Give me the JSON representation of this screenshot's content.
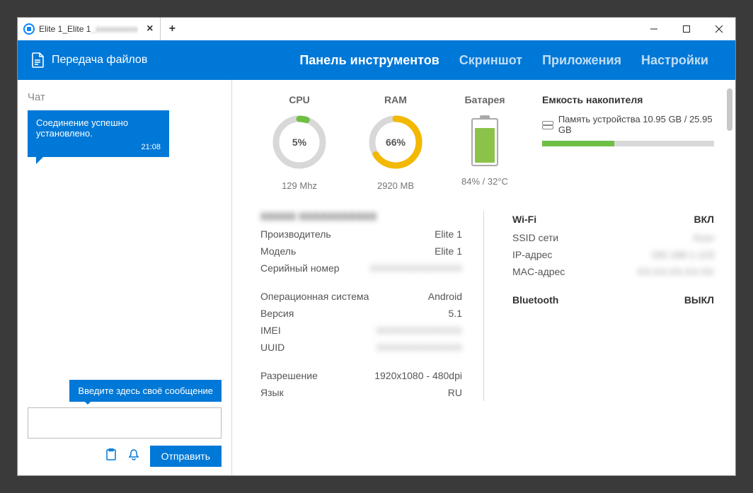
{
  "titlebar": {
    "tab_title": "Elite 1_Elite 1",
    "tab_blur_suffix": "_xxxxxxxxxx"
  },
  "header": {
    "file_transfer": "Передача файлов",
    "tabs": {
      "dashboard": "Панель инструментов",
      "screenshot": "Скриншот",
      "apps": "Приложения",
      "settings": "Настройки"
    }
  },
  "chat": {
    "title": "Чат",
    "message_text": "Соединение успешно установлено.",
    "message_time": "21:08",
    "tooltip": "Введите здесь своё сообщение",
    "send": "Отправить"
  },
  "gauges": {
    "cpu": {
      "label": "CPU",
      "value": "5%",
      "percent": 5,
      "sub": "129 Mhz",
      "color": "#6fbf44"
    },
    "ram": {
      "label": "RAM",
      "value": "66%",
      "percent": 66,
      "sub": "2920 MB",
      "color": "#f3b800"
    },
    "battery": {
      "label": "Батарея",
      "percent": 84,
      "sub": "84% / 32°C"
    }
  },
  "storage": {
    "title": "Емкость накопителя",
    "device_memory": "Память устройства 10.95 GB / 25.95 GB",
    "used_percent": 42
  },
  "device": {
    "heading": "XXXXX XXXXXXXXXXX",
    "rows_a": [
      {
        "k": "Производитель",
        "v": "Elite 1"
      },
      {
        "k": "Модель",
        "v": "Elite 1"
      },
      {
        "k": "Серийный номер",
        "v": "XXXXXXXXXXXXXX",
        "blur": true
      }
    ],
    "rows_b": [
      {
        "k": "Операционная система",
        "v": "Android"
      },
      {
        "k": "Версия",
        "v": "5.1"
      },
      {
        "k": "IMEI",
        "v": "XXXXXXXXXXXXX",
        "blur": true
      },
      {
        "k": "UUID",
        "v": "XXXXXXXXXXXXX",
        "blur": true
      }
    ],
    "rows_c": [
      {
        "k": "Разрешение",
        "v": "1920x1080 - 480dpi"
      },
      {
        "k": "Язык",
        "v": "RU"
      }
    ]
  },
  "network": {
    "wifi": {
      "label": "Wi-Fi",
      "state": "ВКЛ"
    },
    "wifi_rows": [
      {
        "k": "SSID сети",
        "v": "Xxxx",
        "blur": true
      },
      {
        "k": "IP-адрес",
        "v": "192.168.1.123",
        "blur": true
      },
      {
        "k": "MAC-адрес",
        "v": "XX:XX:XX:XX:XX",
        "blur": true
      }
    ],
    "bluetooth": {
      "label": "Bluetooth",
      "state": "ВЫКЛ"
    }
  }
}
